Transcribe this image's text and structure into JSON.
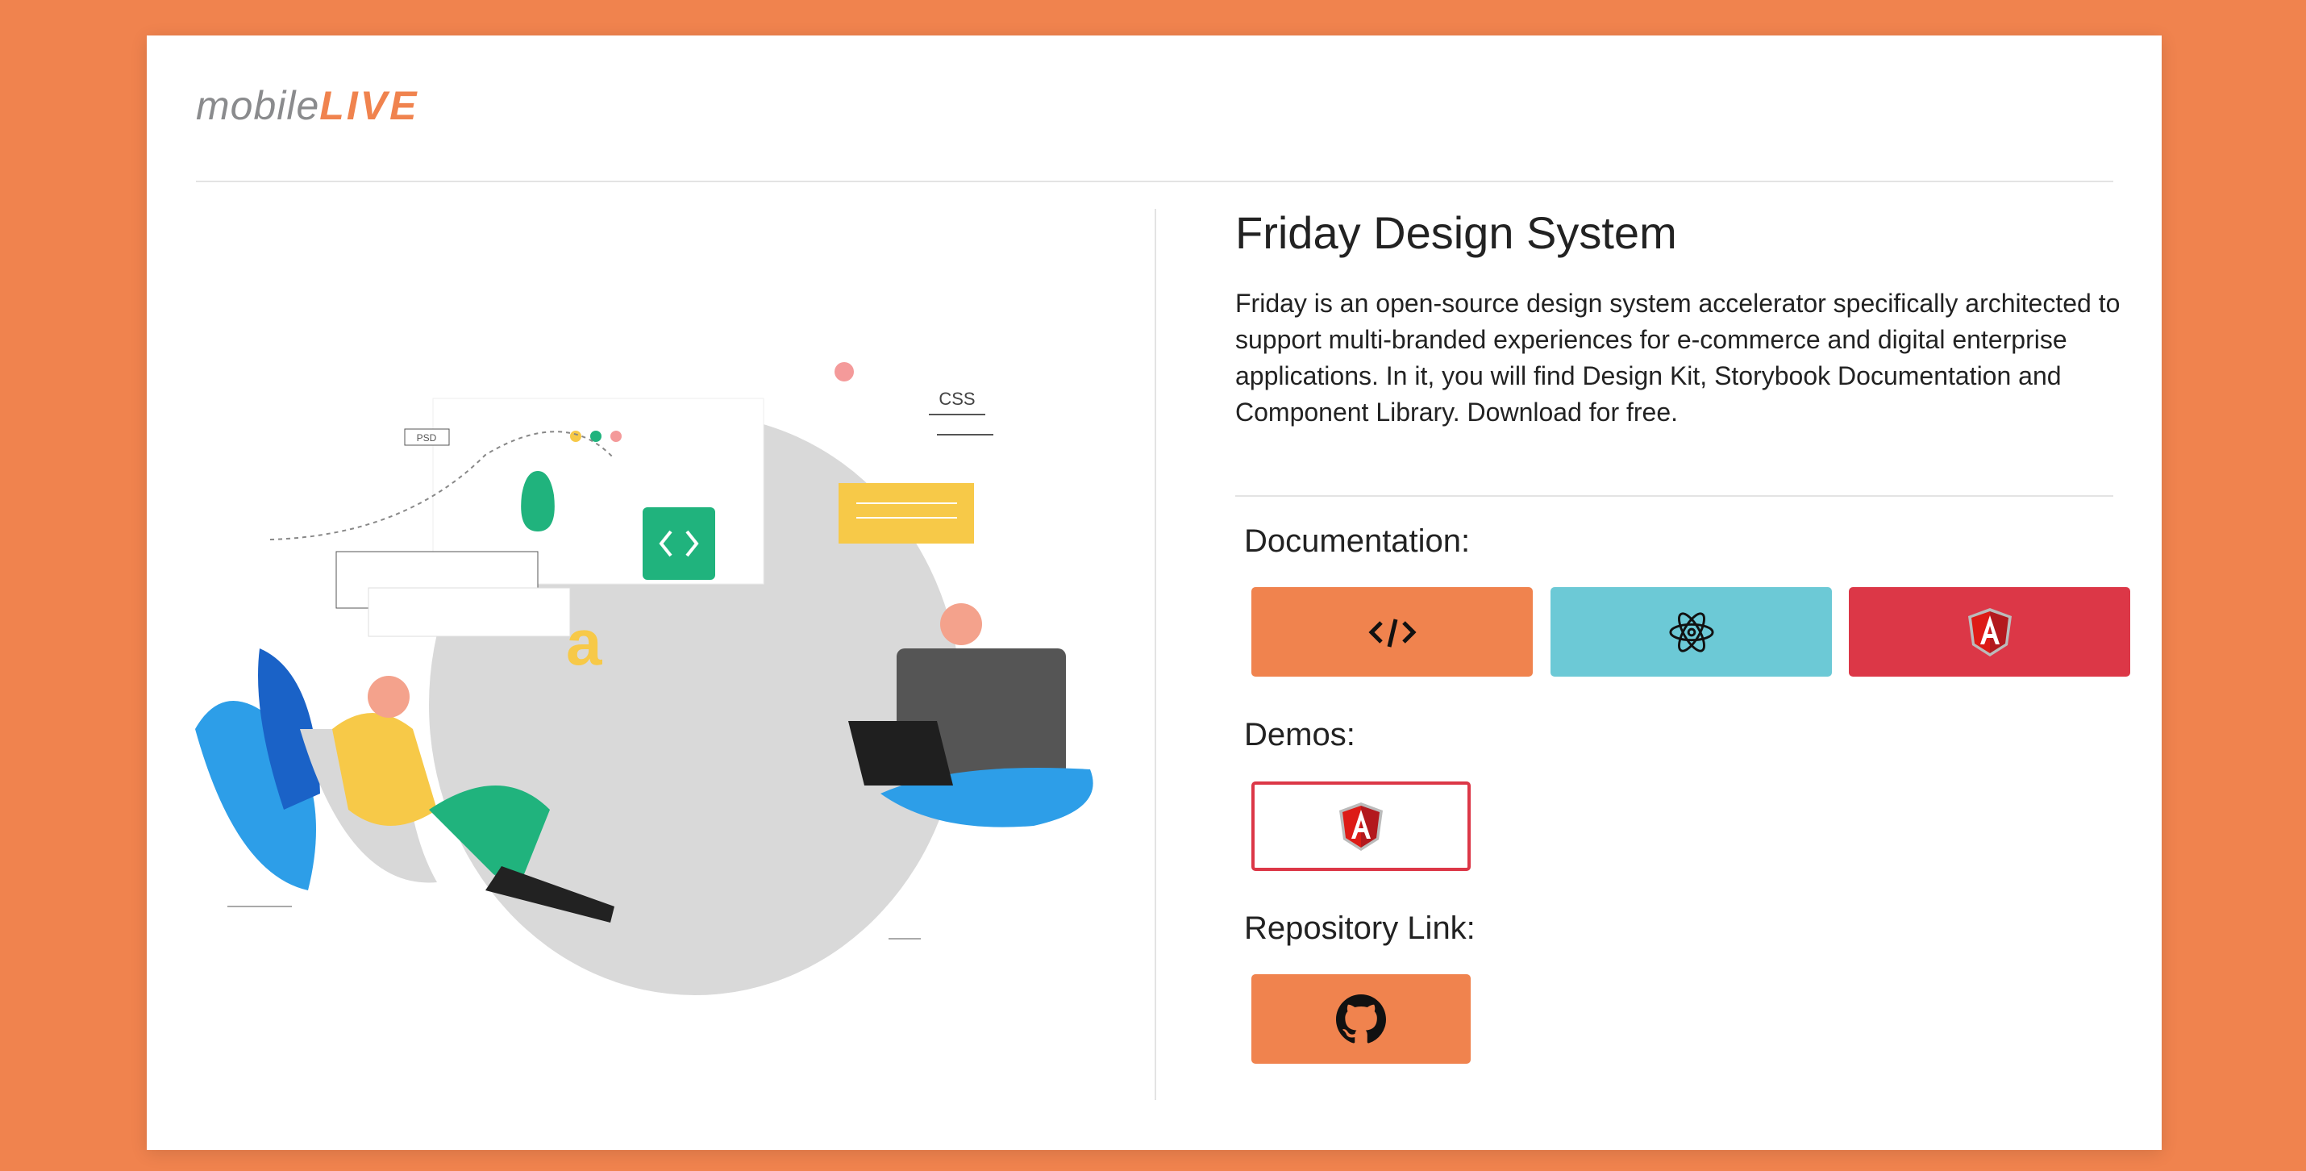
{
  "logo": {
    "text_mobile": "mobile",
    "text_live": "LIVE"
  },
  "main": {
    "title": "Friday Design System",
    "description": "Friday is an open-source design system accelerator specifically architected to support multi-branded experiences for e-commerce and digital enterprise applications. In it, you will find Design Kit, Storybook Documentation and Component Library. Download for free.",
    "sections": {
      "documentation": {
        "label": "Documentation:",
        "buttons": [
          {
            "icon": "code-icon",
            "color": "#f0834e"
          },
          {
            "icon": "react-icon",
            "color": "#6cc9d6"
          },
          {
            "icon": "angular-icon",
            "color": "#dc3747"
          }
        ]
      },
      "demos": {
        "label": "Demos:",
        "buttons": [
          {
            "icon": "angular-icon",
            "border_color": "#dc3747"
          }
        ]
      },
      "repository": {
        "label": "Repository Link:",
        "buttons": [
          {
            "icon": "github-icon",
            "color": "#f0834e"
          }
        ]
      }
    }
  },
  "illustration": {
    "psd_label": "PSD",
    "css_label": "CSS",
    "type_glyph": "a"
  },
  "colors": {
    "background": "#f0834e",
    "accent": "#f0834e",
    "react": "#6cc9d6",
    "angular": "#dc3747"
  }
}
